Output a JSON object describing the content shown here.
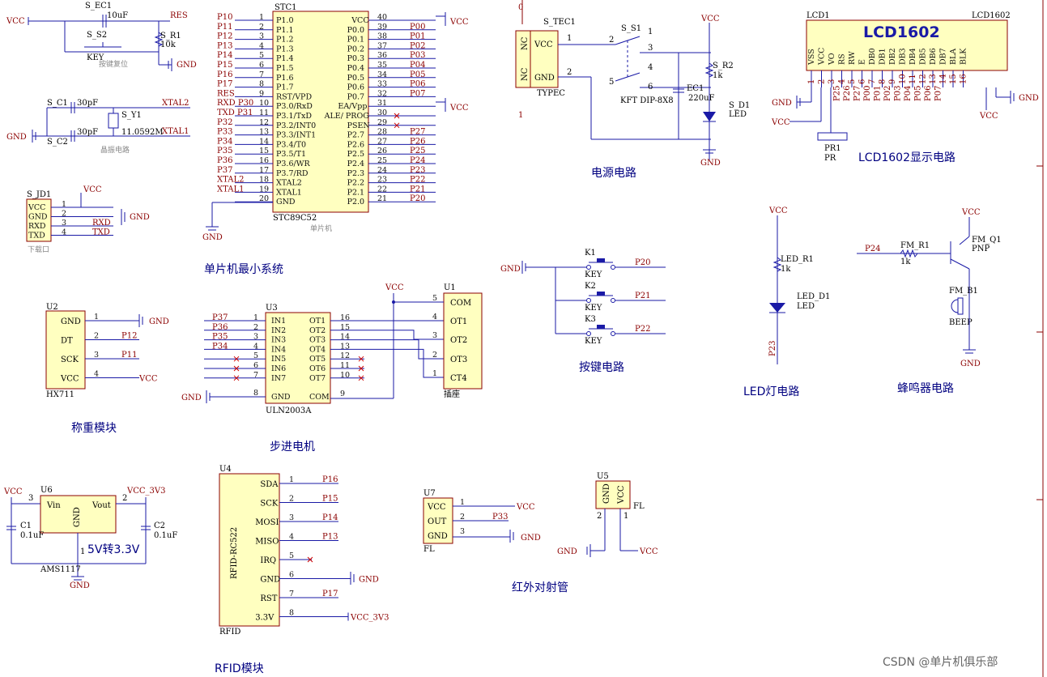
{
  "sections": {
    "mcu": "单片机最小系统",
    "power": "电源电路",
    "lcd": "LCD1602显示电路",
    "keys": "按键电路",
    "led": "LED灯电路",
    "buzzer": "蜂鸣器电路",
    "weigh": "称重模块",
    "stepper": "步进电机",
    "rfid": "RFID模块",
    "ir": "红外对射管",
    "regulator_caption": "5V转3.3V",
    "crystal_caption": "晶振电路",
    "reset_caption": "按键复位",
    "mcu_caption": "单片机",
    "download_caption": "下载口"
  },
  "watermark": "CSDN @单片机俱乐部",
  "nets": {
    "vcc": "VCC",
    "gnd": "GND",
    "vcc33": "VCC_3V3",
    "res": "RES",
    "xtal1": "XTAL1",
    "xtal2": "XTAL2",
    "rxd": "RXD",
    "txd": "TXD"
  },
  "parts": {
    "stc_ref": "STC1",
    "stc_val": "STC89C52",
    "sec1": "S_EC1",
    "sec1_val": "10uF",
    "ss2": "S_S2",
    "key": "KEY",
    "sr1": "S_R1",
    "sr1_val": "10k",
    "sc1": "S_C1",
    "sc2": "S_C2",
    "cap30": "30pF",
    "sy1": "S_Y1",
    "sy1_val": "11.0592M",
    "sjd1": "S_JD1",
    "stec1": "S_TEC1",
    "typec": "TYPEC",
    "ss1": "S_S1",
    "kft": "KFT DIP-8X8",
    "sec_cap": "EC1",
    "sec_val": "220uF",
    "sr2": "S_R2",
    "r1k": "1k",
    "sd1": "S_D1",
    "led": "LED",
    "lcd_ref": "LCD1",
    "lcd_val": "LCD1602",
    "lcd_title": "LCD1602",
    "pr1": "PR1",
    "pr": "PR",
    "k1": "K1",
    "k2": "K2",
    "k3": "K3",
    "ledr1": "LED_R1",
    "ledd1": "LED_D1",
    "fmr1": "FM_R1",
    "fmq1": "FM_Q1",
    "pnp": "PNP",
    "fmb1": "FM_B1",
    "beep": "BEEP",
    "u2": "U2",
    "hx711": "HX711",
    "u3": "U3",
    "uln": "ULN2003A",
    "u1": "U1",
    "socket": "插座",
    "u6": "U6",
    "ams": "AMS1117",
    "c1": "C1",
    "c2": "C2",
    "c01": "0.1uF",
    "u4": "U4",
    "rfid_val": "RFID",
    "rfid_body": "RFID-RC522",
    "u7": "U7",
    "u5": "U5",
    "fl": "FL"
  },
  "stc": {
    "left": [
      {
        "pin": "1",
        "name": "P1.0",
        "net": "P10"
      },
      {
        "pin": "2",
        "name": "P1.1",
        "net": "P11"
      },
      {
        "pin": "3",
        "name": "P1.2",
        "net": "P12"
      },
      {
        "pin": "4",
        "name": "P1.3",
        "net": "P13"
      },
      {
        "pin": "5",
        "name": "P1.4",
        "net": "P14"
      },
      {
        "pin": "6",
        "name": "P1.5",
        "net": "P15"
      },
      {
        "pin": "7",
        "name": "P1.6",
        "net": "P16"
      },
      {
        "pin": "8",
        "name": "P1.7",
        "net": "P17"
      },
      {
        "pin": "9",
        "name": "RST/VPD",
        "net": "RES"
      },
      {
        "pin": "10",
        "name": "P3.0/RxD",
        "net": "RXD P30"
      },
      {
        "pin": "11",
        "name": "P3.1/TxD",
        "net": "TXD P31"
      },
      {
        "pin": "12",
        "name": "P3.2/INT0",
        "net": "P32"
      },
      {
        "pin": "13",
        "name": "P3.3/INT1",
        "net": "P33"
      },
      {
        "pin": "14",
        "name": "P3.4/T0",
        "net": "P34"
      },
      {
        "pin": "15",
        "name": "P3.5/T1",
        "net": "P35"
      },
      {
        "pin": "16",
        "name": "P3.6/WR",
        "net": "P36"
      },
      {
        "pin": "17",
        "name": "P3.7/RD",
        "net": "P37"
      },
      {
        "pin": "18",
        "name": "XTAL2",
        "net": "XTAL2"
      },
      {
        "pin": "19",
        "name": "XTAL1",
        "net": "XTAL1"
      },
      {
        "pin": "20",
        "name": "GND",
        "net": ""
      }
    ],
    "right": [
      {
        "pin": "40",
        "name": "VCC",
        "net": "VCC"
      },
      {
        "pin": "39",
        "name": "P0.0",
        "net": "P00"
      },
      {
        "pin": "38",
        "name": "P0.1",
        "net": "P01"
      },
      {
        "pin": "37",
        "name": "P0.2",
        "net": "P02"
      },
      {
        "pin": "36",
        "name": "P0.3",
        "net": "P03"
      },
      {
        "pin": "35",
        "name": "P0.4",
        "net": "P04"
      },
      {
        "pin": "34",
        "name": "P0.5",
        "net": "P05"
      },
      {
        "pin": "33",
        "name": "P0.6",
        "net": "P06"
      },
      {
        "pin": "32",
        "name": "P0.7",
        "net": "P07"
      },
      {
        "pin": "31",
        "name": "EA/Vpp",
        "net": "VCC"
      },
      {
        "pin": "30",
        "name": "ALE/ PROG",
        "net": ""
      },
      {
        "pin": "29",
        "name": "PSEN",
        "net": ""
      },
      {
        "pin": "28",
        "name": "P2.7",
        "net": "P27"
      },
      {
        "pin": "27",
        "name": "P2.6",
        "net": "P26"
      },
      {
        "pin": "26",
        "name": "P2.5",
        "net": "P25"
      },
      {
        "pin": "25",
        "name": "P2.4",
        "net": "P24"
      },
      {
        "pin": "24",
        "name": "P2.3",
        "net": "P23"
      },
      {
        "pin": "23",
        "name": "P2.2",
        "net": "P22"
      },
      {
        "pin": "22",
        "name": "P2.1",
        "net": "P21"
      },
      {
        "pin": "21",
        "name": "P2.0",
        "net": "P20"
      }
    ]
  },
  "download": [
    {
      "pin": "1",
      "name": "VCC",
      "net": "VCC"
    },
    {
      "pin": "2",
      "name": "GND",
      "net": "GND"
    },
    {
      "pin": "3",
      "name": "RXD",
      "net": "RXD"
    },
    {
      "pin": "4",
      "name": "TXD",
      "net": "TXD"
    }
  ],
  "lcd_pins": [
    {
      "name": "VSS",
      "num": "1",
      "net": ""
    },
    {
      "name": "VCC",
      "num": "2",
      "net": ""
    },
    {
      "name": "VO",
      "num": "3",
      "net": ""
    },
    {
      "name": "RS",
      "num": "4",
      "net": "P25"
    },
    {
      "name": "RW",
      "num": "5",
      "net": "P26"
    },
    {
      "name": "E",
      "num": "6",
      "net": "P27"
    },
    {
      "name": "DB0",
      "num": "7",
      "net": "P00"
    },
    {
      "name": "DB1",
      "num": "8",
      "net": "P01"
    },
    {
      "name": "DB2",
      "num": "9",
      "net": "P02"
    },
    {
      "name": "DB3",
      "num": "10",
      "net": "P03"
    },
    {
      "name": "DB4",
      "num": "11",
      "net": "P04"
    },
    {
      "name": "DB5",
      "num": "12",
      "net": "P05"
    },
    {
      "name": "DB6",
      "num": "13",
      "net": "P06"
    },
    {
      "name": "DB7",
      "num": "14",
      "net": "P07"
    },
    {
      "name": "BLA",
      "num": "15",
      "net": ""
    },
    {
      "name": "BLK",
      "num": "16",
      "net": ""
    }
  ],
  "keys": [
    {
      "ref": "K1",
      "net": "P20"
    },
    {
      "ref": "K2",
      "net": "P21"
    },
    {
      "ref": "K3",
      "net": "P22"
    }
  ],
  "hx711": [
    {
      "pin": "1",
      "name": "GND",
      "net": "GND"
    },
    {
      "pin": "2",
      "name": "DT",
      "net": "P12"
    },
    {
      "pin": "3",
      "name": "SCK",
      "net": "P11"
    },
    {
      "pin": "4",
      "name": "VCC",
      "net": "VCC"
    }
  ],
  "uln": {
    "in": [
      {
        "pin": "1",
        "name": "IN1",
        "net": "P37"
      },
      {
        "pin": "2",
        "name": "IN2",
        "net": "P36"
      },
      {
        "pin": "3",
        "name": "IN3",
        "net": "P35"
      },
      {
        "pin": "4",
        "name": "IN4",
        "net": "P34"
      },
      {
        "pin": "5",
        "name": "IN5",
        "net": ""
      },
      {
        "pin": "6",
        "name": "IN6",
        "net": ""
      },
      {
        "pin": "7",
        "name": "IN7",
        "net": ""
      },
      {
        "pin": "8",
        "name": "GND",
        "net": "GND"
      }
    ],
    "out": [
      {
        "pin": "16",
        "name": "OT1"
      },
      {
        "pin": "15",
        "name": "OT2"
      },
      {
        "pin": "14",
        "name": "OT3"
      },
      {
        "pin": "13",
        "name": "OT4"
      },
      {
        "pin": "12",
        "name": "OT5"
      },
      {
        "pin": "11",
        "name": "OT6"
      },
      {
        "pin": "10",
        "name": "OT7"
      },
      {
        "pin": "9",
        "name": "COM"
      }
    ]
  },
  "socket": [
    {
      "pin": "5",
      "name": "COM"
    },
    {
      "pin": "4",
      "name": "OT1"
    },
    {
      "pin": "3",
      "name": "OT2"
    },
    {
      "pin": "2",
      "name": "OT3"
    },
    {
      "pin": "1",
      "name": "CT4"
    }
  ],
  "ams": {
    "vin": "Vin",
    "vout": "Vout",
    "gnd": "GND",
    "p3": "3",
    "p2": "2",
    "p1": "1"
  },
  "rfid": [
    {
      "pin": "1",
      "name": "SDA",
      "net": "P16"
    },
    {
      "pin": "2",
      "name": "SCK",
      "net": "P15"
    },
    {
      "pin": "3",
      "name": "MOSI",
      "net": "P14"
    },
    {
      "pin": "4",
      "name": "MISO",
      "net": "P13"
    },
    {
      "pin": "5",
      "name": "IRQ",
      "net": ""
    },
    {
      "pin": "6",
      "name": "GND",
      "net": "GND"
    },
    {
      "pin": "7",
      "name": "RST",
      "net": "P17"
    },
    {
      "pin": "8",
      "name": "3.3V",
      "net": "VCC_3V3"
    }
  ],
  "u7": [
    {
      "pin": "1",
      "name": "VCC",
      "net": "VCC"
    },
    {
      "pin": "2",
      "name": "OUT",
      "net": "P33"
    },
    {
      "pin": "3",
      "name": "GND",
      "net": "GND"
    }
  ],
  "u5": {
    "gnd": "GND",
    "vcc": "VCC",
    "p2": "2",
    "p1": "1"
  },
  "misc": {
    "stec_pins": [
      "NC",
      "VCC",
      "NC",
      "GND"
    ],
    "stec_nums": [
      "1",
      "2"
    ],
    "ss1_nums": [
      "2",
      "1",
      "3",
      "4",
      "5",
      "6"
    ],
    "ledr_net": "P23",
    "fm_net": "P24",
    "res_net": "RES",
    "frame_ticks": [
      "0",
      "1"
    ]
  }
}
